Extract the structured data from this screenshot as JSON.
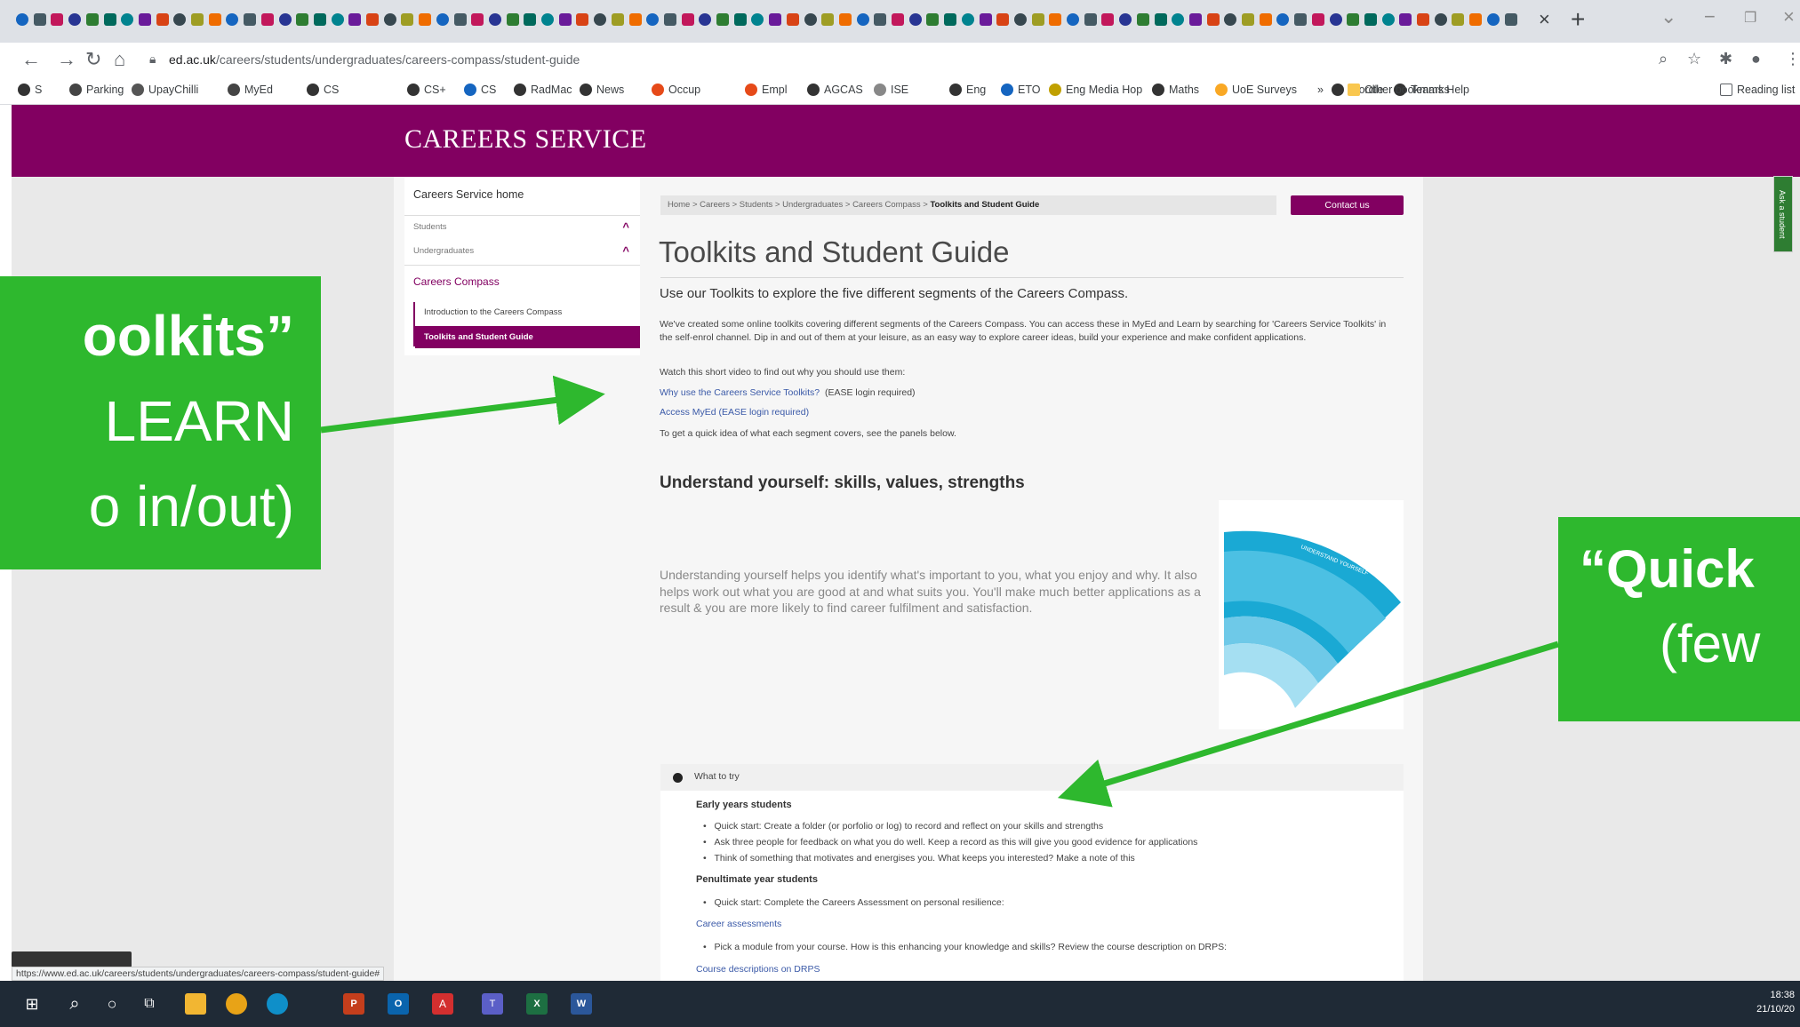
{
  "browser": {
    "url_host": "ed.ac.uk",
    "url_path": "/careers/students/undergraduates/careers-compass/student-guide",
    "close_glyph": "×",
    "newtab_glyph": "+",
    "bookmarks": [
      {
        "label": "S",
        "color": "#333"
      },
      {
        "label": "Parking",
        "color": "#444"
      },
      {
        "label": "UpayChilli",
        "color": "#555"
      },
      {
        "label": "MyEd",
        "color": "#444"
      },
      {
        "label": "CS",
        "color": "#333"
      },
      {
        "label": "CS+",
        "color": "#333"
      },
      {
        "label": "CS",
        "color": "#1565c0"
      },
      {
        "label": "RadMac",
        "color": "#333"
      },
      {
        "label": "News",
        "color": "#333"
      },
      {
        "label": "Occup",
        "color": "#e64a19"
      },
      {
        "label": "Empl",
        "color": "#e64a19"
      },
      {
        "label": "AGCAS",
        "color": "#333"
      },
      {
        "label": "ISE",
        "color": "#888"
      },
      {
        "label": "Eng",
        "color": "#333"
      },
      {
        "label": "ETO",
        "color": "#1565c0"
      },
      {
        "label": "Eng Media Hop",
        "color": "#c0a000"
      },
      {
        "label": "Maths",
        "color": "#333"
      },
      {
        "label": "UoE Surveys",
        "color": "#f9a825"
      },
      {
        "label": "Wordle",
        "color": "#333"
      },
      {
        "label": "Teams Help",
        "color": "#333"
      }
    ],
    "bm_more": "»",
    "other_bookmarks": "Other bookmarks",
    "reading_list": "Reading list"
  },
  "site": {
    "title": "CAREERS SERVICE",
    "ask_tab": "Ask a student"
  },
  "sidenav": {
    "home": "Careers Service home",
    "students": "Students",
    "undergraduates": "Undergraduates",
    "compass": "Careers Compass",
    "intro": "Introduction to the Careers Compass",
    "active": "Toolkits and Student Guide"
  },
  "breadcrumb": {
    "path": "Home  >  Careers  >  Students  >  Undergraduates  >  Careers Compass  >  ",
    "current": "Toolkits and Student Guide"
  },
  "contact_label": "Contact us",
  "main": {
    "title": "Toolkits and Student Guide",
    "lead": "Use our Toolkits to explore the five different segments of the Careers Compass.",
    "p1": "We've created some online toolkits covering different segments of the Careers Compass. You can access these in MyEd and Learn by searching for 'Careers Service Toolkits' in the self-enrol channel. Dip in and out of them at your leisure, as an easy way to explore career ideas, build your experience and make confident applications.",
    "p2": "Watch this short video to find out why you should use them:",
    "link1": "Why use the Careers Service Toolkits?",
    "link1_note": "(EASE login required)",
    "link2": "Access MyEd (EASE login required)",
    "p3": "To get a quick idea of what each segment covers, see the panels below.",
    "section_heading": "Understand yourself: skills, values, strengths",
    "section_text": "Understanding yourself helps you identify what's important to you, what you enjoy and why. It also helps work out what you are good at and what suits you. You'll make much better applications as a result & you are more likely to find career fulfilment and satisfaction.",
    "compass_segment_label": "UNDERSTAND YOURSELF"
  },
  "accordion": {
    "title": "What to try",
    "early_heading": "Early years students",
    "early_items": [
      "Quick start: Create a folder (or porfolio or log)  to record and reflect on your skills and strengths",
      "Ask three people for feedback on what you do well. Keep a record as this will give you good evidence for applications",
      "Think of something that motivates and energises you. What keeps you interested? Make a note of this"
    ],
    "penult_heading": "Penultimate year students",
    "penult_item1": "Quick start: Complete the Careers Assessment on personal resilience:",
    "link_assess": "Career assessments",
    "penult_item2": "Pick a module from your course. How is this enhancing your knowledge and skills? Review the course description on DRPS:",
    "link_drps": "Course descriptions on DRPS"
  },
  "status_url": "https://www.ed.ac.uk/careers/students/undergraduates/careers-compass/student-guide#",
  "callouts": {
    "left_line1": "oolkits”",
    "left_line2": "LEARN",
    "left_line3": "o in/out)",
    "right_line1": "“Quick",
    "right_line2": "(few"
  },
  "taskbar": {
    "time": "18:38",
    "date": "21/10/20"
  },
  "colors": {
    "brand": "#820061",
    "callout": "#2eb82e",
    "link": "#3b5aa8"
  }
}
